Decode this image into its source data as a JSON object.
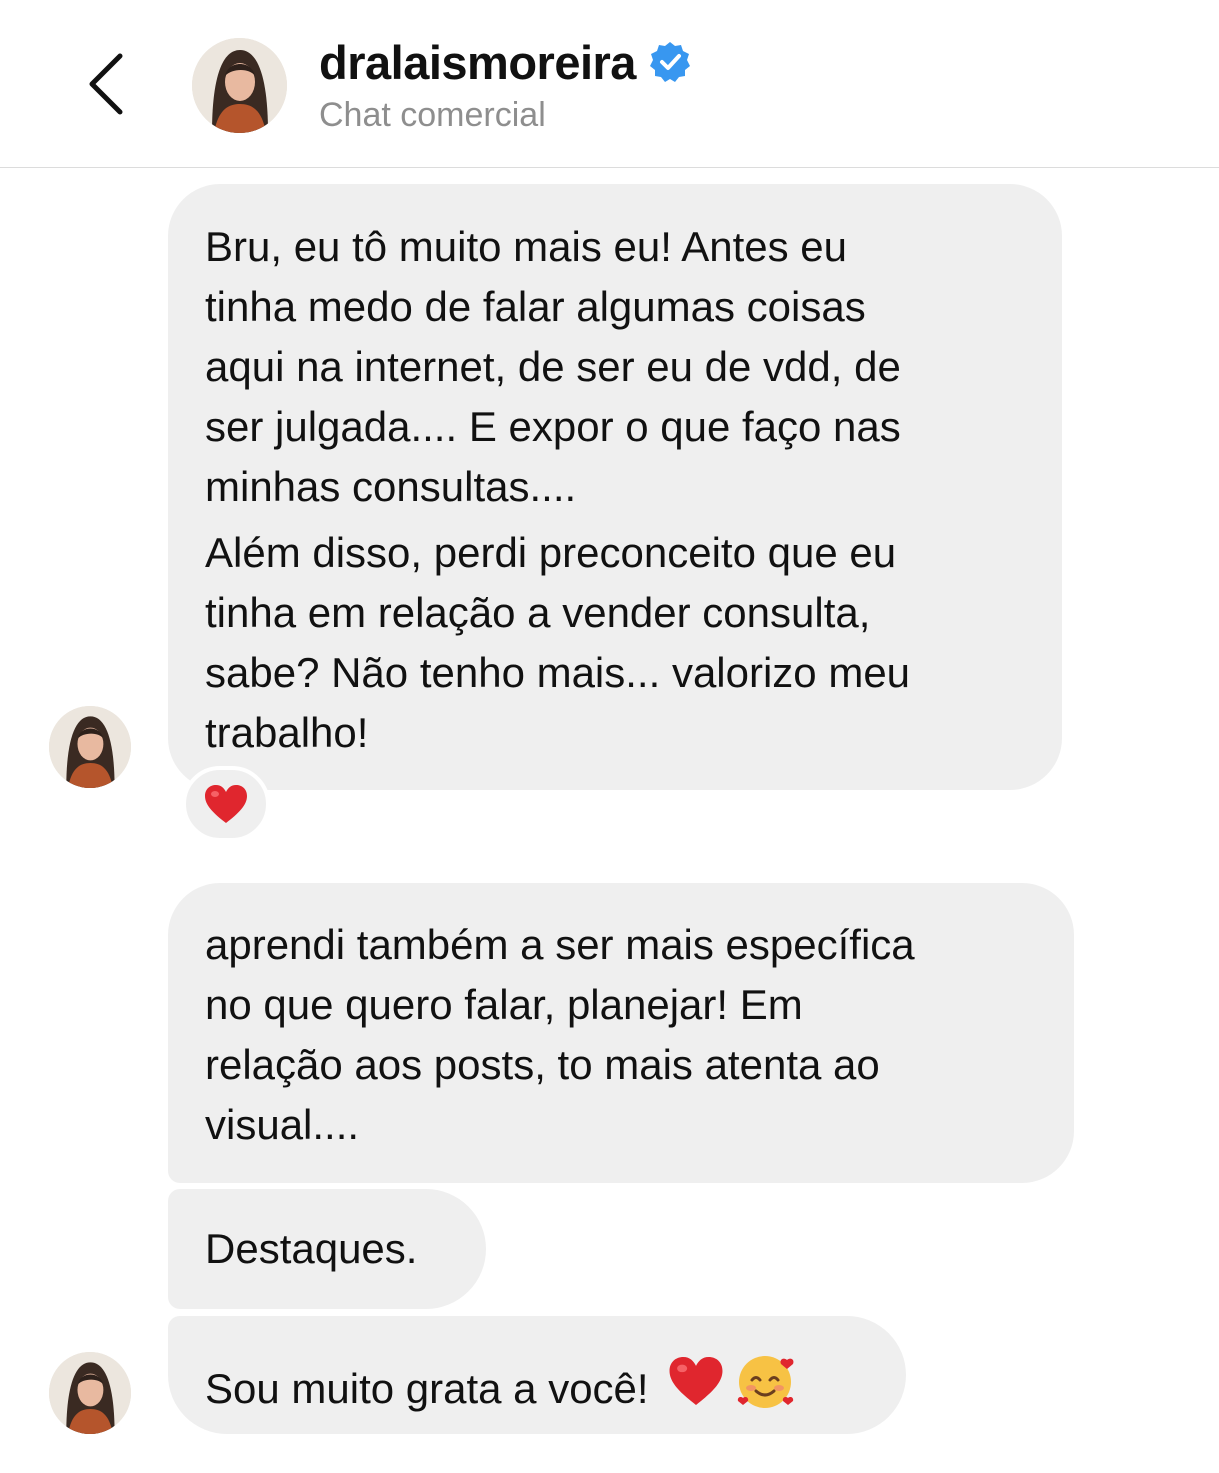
{
  "header": {
    "back_icon": "chevron-left-icon",
    "username": "dralaismoreira",
    "verified_icon": "verified-badge-icon",
    "subtitle": "Chat comercial"
  },
  "messages": [
    {
      "paragraphs": [
        "Bru, eu tô muito mais eu! Antes eu\ntinha medo de falar algumas coisas\naqui na internet, de ser eu de vdd, de\nser julgada.... E expor o que faço nas\nminhas consultas....",
        "Além disso, perdi preconceito que eu\ntinha em relação a vender consulta,\nsabe? Não tenho mais... valorizo meu\ntrabalho!"
      ],
      "reaction": "red-heart-icon"
    },
    {
      "text": "aprendi também a ser mais específica\nno que quero falar, planejar! Em\nrelação aos posts, to mais atenta ao\nvisual...."
    },
    {
      "text": "Destaques."
    },
    {
      "text": "Sou muito grata a você!",
      "emojis": [
        "red-heart-icon",
        "smiling-face-with-hearts-icon"
      ]
    }
  ],
  "colors": {
    "bubble": "#efefef",
    "verified": "#3897f0",
    "heart": "#e0262e",
    "subtitle": "#8e8e8e"
  }
}
